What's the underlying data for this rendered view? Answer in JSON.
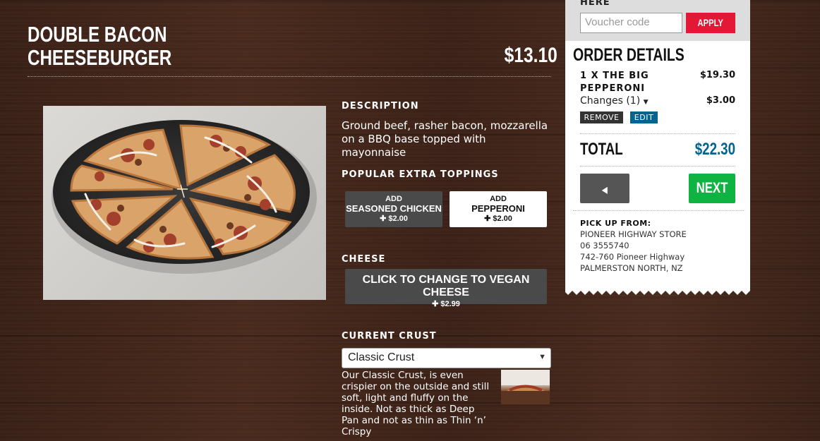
{
  "product": {
    "title_line1": "DOUBLE BACON",
    "title_line2": "CHEESEBURGER",
    "price": "$13.10",
    "image_alt": "pizza-photo"
  },
  "description": {
    "label": "DESCRIPTION",
    "text": "Ground beef, rasher bacon, mozzarella on a BBQ base topped with mayonnaise"
  },
  "extra_toppings": {
    "label": "POPULAR EXTRA TOPPINGS",
    "items": [
      {
        "add": "ADD",
        "name": "SEASONED CHICKEN",
        "price": "✚ $2.00",
        "style": "dark"
      },
      {
        "add": "ADD",
        "name": "PEPPERONI",
        "price": "✚ $2.00",
        "style": "light"
      }
    ]
  },
  "cheese": {
    "label": "CHEESE",
    "button_line1": "CLICK TO CHANGE TO VEGAN CHEESE",
    "button_line2": "✚ $2.99"
  },
  "crust": {
    "label": "CURRENT CRUST",
    "selected": "Classic Crust",
    "description": "Our Classic Crust, is even crispier on the outside and still soft, light and fluffy on the inside. Not as thick as Deep Pan and not as thin as Thin ‘n’ Crispy"
  },
  "voucher": {
    "label": "HERE",
    "placeholder": "Voucher code",
    "apply_label": "APPLY"
  },
  "order": {
    "title": "ORDER DETAILS",
    "item_name": "1 X THE BIG PEPPERONI",
    "item_price": "$19.30",
    "changes_label": "Changes (1)",
    "changes_price": "$3.00",
    "remove_label": "REMOVE",
    "edit_label": "EDIT",
    "total_label": "TOTAL",
    "total_value": "$22.30",
    "back_label": "BACK",
    "next_label": "NEXT"
  },
  "pickup": {
    "label": "PICK UP FROM:",
    "store": "PIONEER HIGHWAY STORE",
    "phone": "06 3555740",
    "address": "742-760 Pioneer Highway",
    "city": "PALMERSTON NORTH, NZ"
  },
  "colors": {
    "accent_red": "#e31837",
    "accent_blue": "#006491",
    "next_green": "#0fb341"
  }
}
